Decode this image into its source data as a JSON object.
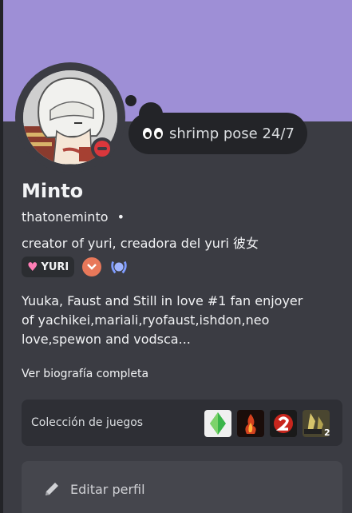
{
  "profile": {
    "display_name": "Minto",
    "username": "thatoneminto",
    "username_separator": "•",
    "status_text": "shrimp pose 24/7",
    "bio_short": "creator of yuri, creadora del yuri 彼女",
    "bio_lines": [
      "Yuuka, Faust and Still in love #1 fan enjoyer",
      "of yachikei,mariali,ryofaust,ishdon,neo",
      "love,spewon and vodsca..."
    ],
    "see_more": "Ver biografía completa",
    "avatar_icon": "anime-avatar",
    "presence": "do-not-disturb"
  },
  "badges": {
    "tag_label": "YURI",
    "tag_icon": "pink-heart-icon",
    "badge_icons": [
      "orange-chevron-icon",
      "blue-laurel-icon"
    ]
  },
  "games": {
    "label": "Colección de juegos",
    "items": [
      "sims-plumbob-icon",
      "fire-game-icon",
      "left4dead2-icon",
      "left4dead2-cover-icon"
    ]
  },
  "actions": {
    "edit_label": "Editar perfil",
    "edit_icon": "pencil-icon"
  },
  "colors": {
    "banner": "#9e8fd6",
    "card": "#3b3c43",
    "dnd": "#da373c"
  }
}
